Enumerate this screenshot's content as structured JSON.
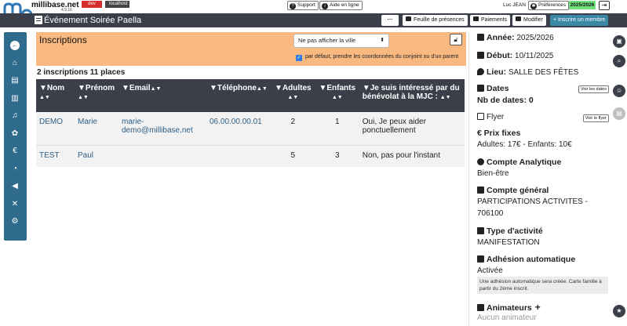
{
  "app": {
    "brand": "millibase.net",
    "version": "4.9.16",
    "env_tag": "dev",
    "host_tag": "localhost"
  },
  "topbar": {
    "support": "Support",
    "help": "Aide en ligne",
    "user": "Luc JEAN",
    "preferences": "Préférences",
    "season": "2025/2026"
  },
  "titlebar": {
    "title": "Événement Soirée Paella",
    "more": "···",
    "attendance": "Feuille de présences",
    "payments": "Paiements",
    "edit": "Modifier",
    "add_member": "+ Inscrire un membre"
  },
  "panel": {
    "title": "Inscriptions",
    "city_select": "Ne pas afficher la ville",
    "checkbox_label": "par défaut, prendre les coordonnées du conjoint ou d'un parent",
    "summary": "2 inscriptions 11 places"
  },
  "table": {
    "headers": [
      {
        "label": "Nom",
        "pre": "▼",
        "post": "▲▼"
      },
      {
        "label": "Prénom",
        "pre": "▼",
        "post": "▲▼"
      },
      {
        "label": "Email",
        "pre": "▼",
        "post": "▲▼"
      },
      {
        "label": "Téléphone",
        "pre": "▼",
        "post": "▲▼"
      },
      {
        "label": "Adultes",
        "pre": "▼",
        "post": "▲▼"
      },
      {
        "label": "Enfants",
        "pre": "▼",
        "post": "▲▼"
      },
      {
        "label": "Je suis intéressé par du bénévolat à la MJC :",
        "pre": "▼",
        "post": "▲▼"
      }
    ],
    "rows": [
      {
        "nom": "DEMO",
        "prenom": "Marie",
        "email": "marie-demo@millibase.net",
        "telephone": "06.00.00.00.01",
        "adultes": "2",
        "enfants": "1",
        "benevolat": "Oui, Je peux aider ponctuellement"
      },
      {
        "nom": "TEST",
        "prenom": "Paul",
        "email": "",
        "telephone": "",
        "adultes": "5",
        "enfants": "3",
        "benevolat": "Non, pas pour l'instant"
      }
    ]
  },
  "detail": {
    "annee_label": "Année:",
    "annee_value": "2025/2026",
    "debut_label": "Début:",
    "debut_value": "10/11/2025",
    "lieu_label": "Lieu:",
    "lieu_value": "SALLE DES FÊTES",
    "dates_label": "Dates",
    "dates_btn": "Voir les dates",
    "nb_dates": "Nb de dates: 0",
    "flyer_label": "Flyer",
    "flyer_btn": "Voir le flyer",
    "prix_label": "Prix fixes",
    "prix_value": "Adultes: 17€ - Enfants: 10€",
    "analytique_label": "Compte Analytique",
    "analytique_value": "Bien-être",
    "general_label": "Compte général",
    "general_value_1": "PARTICIPATIONS ACTIVITES -",
    "general_value_2": "706100",
    "type_label": "Type d'activité",
    "type_value": "MANIFESTATION",
    "adhesion_label": "Adhésion automatique",
    "adhesion_value": "Activée",
    "adhesion_note": "Une adhésion automatique sera créée. Carte famille à partir du 2ème inscrit.",
    "animateurs_label": "Animateurs",
    "animateurs_value": "Aucun animateur"
  }
}
